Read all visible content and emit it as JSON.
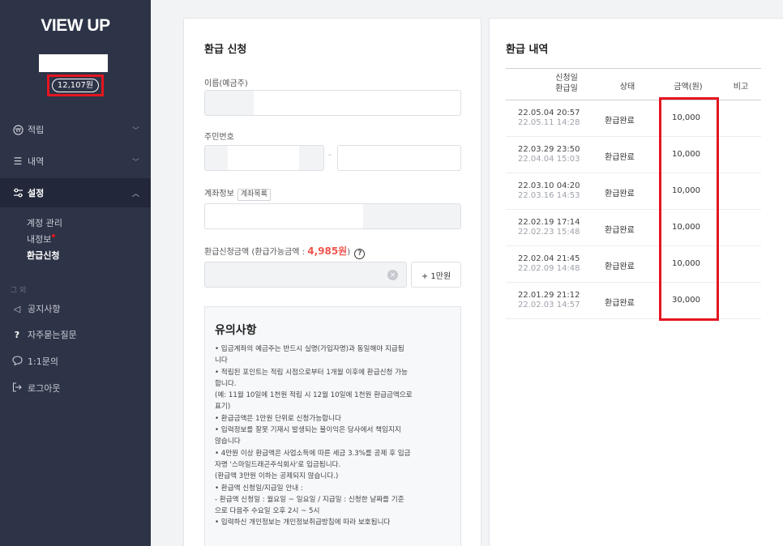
{
  "sidebar": {
    "logo": "VIEW UP",
    "points": "12,107원",
    "menu": {
      "earn": "적립",
      "history": "내역",
      "settings": "설정"
    },
    "sub": {
      "account": "계정 관리",
      "myinfo": "내정보",
      "refund": "환급신청"
    },
    "group_label": "그 외",
    "others": {
      "notice": "공지사항",
      "faq": "자주묻는질문",
      "inquiry": "1:1문의",
      "logout": "로그아웃"
    }
  },
  "refund_form": {
    "title": "환급 신청",
    "name_label": "이름(예금주)",
    "id_label": "주민번호",
    "id_separator": "-",
    "account_label": "계좌정보",
    "account_list_tag": "계좌목록",
    "amount_label": "환급신청금액 (환급가능금액 : ",
    "amount_available": "4,985원",
    "amount_label_end": ")",
    "help": "?",
    "clear": "×",
    "plus_button": "+ 1만원"
  },
  "notice": {
    "title": "유의사항",
    "lines": [
      "• 입금계좌의 예금주는 반드시 실명(가입자명)과 동일해야 지급됩",
      "니다",
      "• 적립된 포인트는 적립 시점으로부터 1개월 이후에 환급신청 가능",
      "합니다.",
      "  (예: 11월 10일에 1천원 적립 시 12월 10일에 1천원 환급금액으로",
      "  표기)",
      "• 환급금액은 1만원 단위로 신청가능합니다",
      "• 입력정보를 잘못 기재시 발생되는 불이익은 당사에서 책임지지",
      "않습니다",
      "• 4만원 이상 환급액은 사업소득에 따른 세금 3.3%를 공제 후 입금",
      "자명 '스마일드래곤주식회사'로 입금됩니다.",
      "  (환급액 3만원 이하는 공제되지 않습니다.)",
      "• 환급액 신청일/지급일 안내 :",
      "  - 환급액 신청일 : 월요일 ~ 일요일 / 지급일 : 신청한 날짜를 기준",
      "  으로 다음주 수요일 오후 2시 ~ 5시",
      "• 입력하신 개인정보는 개인정보취급방침에 따라 보호됩니다"
    ]
  },
  "history": {
    "title": "환급 내역",
    "columns": {
      "date_top": "신청일",
      "date_bottom": "환급일",
      "status": "상태",
      "amount": "금액(원)",
      "note": "비고"
    },
    "rows": [
      {
        "applied": "22.05.04 20:57",
        "paid": "22.05.11 14:28",
        "status": "환급완료",
        "amount": "10,000"
      },
      {
        "applied": "22.03.29 23:50",
        "paid": "22.04.04 15:03",
        "status": "환급완료",
        "amount": "10,000"
      },
      {
        "applied": "22.03.10 04:20",
        "paid": "22.03.16 14:53",
        "status": "환급완료",
        "amount": "10,000"
      },
      {
        "applied": "22.02.19 17:14",
        "paid": "22.02.23 15:48",
        "status": "환급완료",
        "amount": "10,000"
      },
      {
        "applied": "22.02.04 21:45",
        "paid": "22.02.09 14:48",
        "status": "환급완료",
        "amount": "10,000"
      },
      {
        "applied": "22.01.29 21:12",
        "paid": "22.02.03 14:57",
        "status": "환급완료",
        "amount": "30,000"
      }
    ]
  },
  "colors": {
    "sidebar": "#2e3447",
    "highlight": "#e4151f",
    "available": "#f0564d"
  }
}
